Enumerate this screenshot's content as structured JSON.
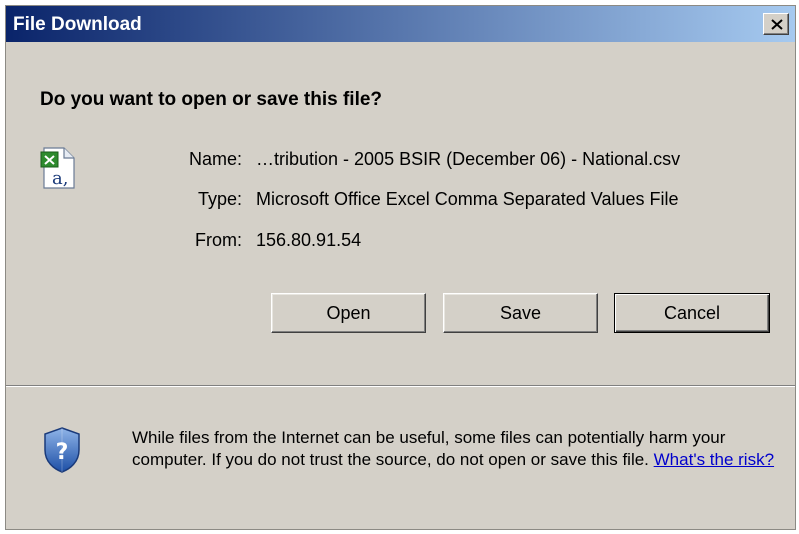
{
  "dialog": {
    "title": "File Download",
    "close_glyph": "×",
    "question": "Do you want to open or save this file?",
    "file_icon": "excel-csv-file-icon",
    "info": {
      "name_label": "Name:",
      "name_value": "…tribution - 2005 BSIR (December 06) - National.csv",
      "type_label": "Type:",
      "type_value": "Microsoft Office Excel Comma Separated Values File",
      "from_label": "From:",
      "from_value": "156.80.91.54"
    },
    "buttons": {
      "open": "Open",
      "save": "Save",
      "cancel": "Cancel"
    },
    "warning": {
      "icon": "shield-question-icon",
      "text": "While files from the Internet can be useful, some files can potentially harm your computer. If you do not trust the source, do not open or save this file. ",
      "link": "What's the risk?"
    }
  },
  "colors": {
    "title_gradient_start": "#0a246a",
    "title_gradient_end": "#a6caf0",
    "dialog_face": "#d4d0c8",
    "link": "#0000cc"
  }
}
